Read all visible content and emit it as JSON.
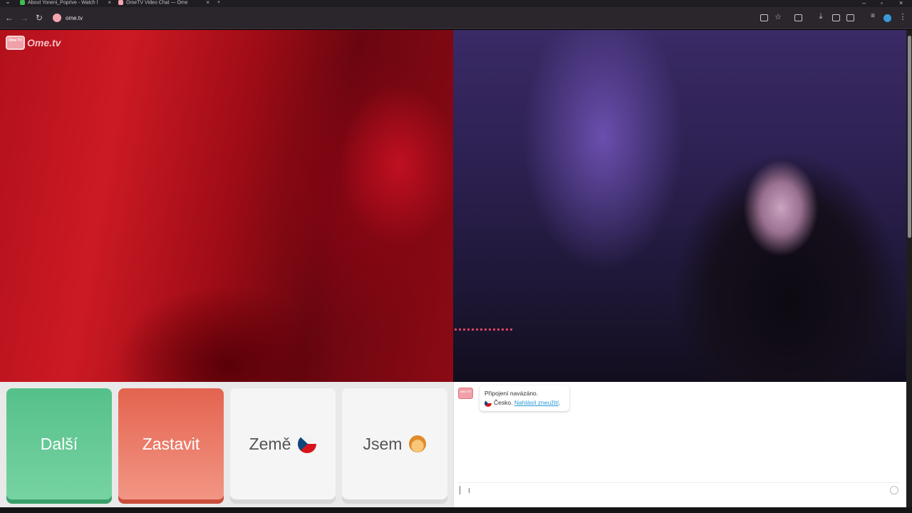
{
  "browser": {
    "tabs": [
      {
        "label": "About Yoneni_Poprive - Watch l",
        "favicon_color": "#3fbf4f"
      },
      {
        "label": "OmeTV Video Chat — Ome",
        "favicon_color": "#f2a4b0"
      }
    ],
    "new_tab_label": "+",
    "url": "ome.tv"
  },
  "logo": {
    "badge": "Ome TV",
    "text": "Ome.tv"
  },
  "buttons": {
    "next_label": "Další",
    "stop_label": "Zastavit",
    "country_label": "Země",
    "gender_label": "Jsem"
  },
  "chat": {
    "avatar_text": "Ome TV",
    "message_line1": "Připojení navázáno.",
    "country": "Česko.",
    "report_link": "Nahlásit zneužití",
    "report_suffix": "."
  },
  "colors": {
    "next": "#55c08a",
    "stop": "#e3644f",
    "brand": "#f0a0a8"
  }
}
